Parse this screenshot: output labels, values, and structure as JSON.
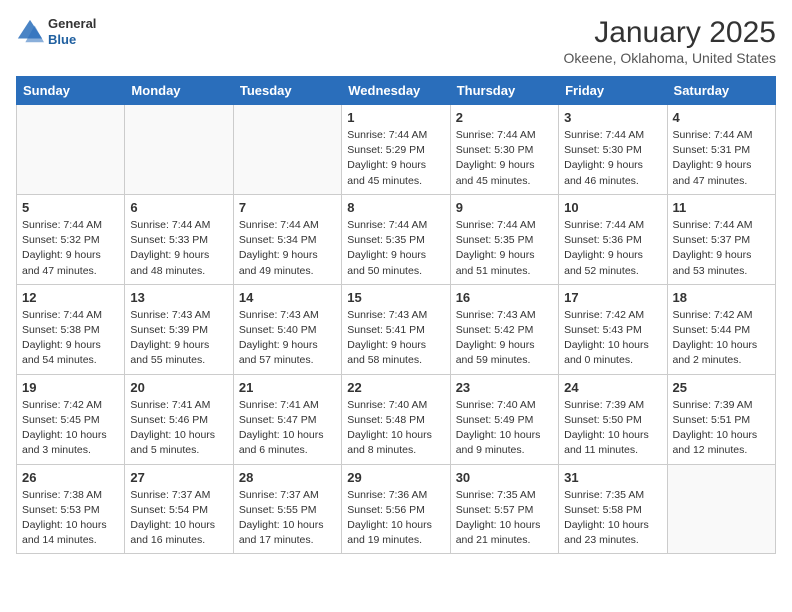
{
  "header": {
    "logo_line1": "General",
    "logo_line2": "Blue",
    "title": "January 2025",
    "subtitle": "Okeene, Oklahoma, United States"
  },
  "days_of_week": [
    "Sunday",
    "Monday",
    "Tuesday",
    "Wednesday",
    "Thursday",
    "Friday",
    "Saturday"
  ],
  "weeks": [
    [
      {
        "day": "",
        "detail": ""
      },
      {
        "day": "",
        "detail": ""
      },
      {
        "day": "",
        "detail": ""
      },
      {
        "day": "1",
        "detail": "Sunrise: 7:44 AM\nSunset: 5:29 PM\nDaylight: 9 hours and 45 minutes."
      },
      {
        "day": "2",
        "detail": "Sunrise: 7:44 AM\nSunset: 5:30 PM\nDaylight: 9 hours and 45 minutes."
      },
      {
        "day": "3",
        "detail": "Sunrise: 7:44 AM\nSunset: 5:30 PM\nDaylight: 9 hours and 46 minutes."
      },
      {
        "day": "4",
        "detail": "Sunrise: 7:44 AM\nSunset: 5:31 PM\nDaylight: 9 hours and 47 minutes."
      }
    ],
    [
      {
        "day": "5",
        "detail": "Sunrise: 7:44 AM\nSunset: 5:32 PM\nDaylight: 9 hours and 47 minutes."
      },
      {
        "day": "6",
        "detail": "Sunrise: 7:44 AM\nSunset: 5:33 PM\nDaylight: 9 hours and 48 minutes."
      },
      {
        "day": "7",
        "detail": "Sunrise: 7:44 AM\nSunset: 5:34 PM\nDaylight: 9 hours and 49 minutes."
      },
      {
        "day": "8",
        "detail": "Sunrise: 7:44 AM\nSunset: 5:35 PM\nDaylight: 9 hours and 50 minutes."
      },
      {
        "day": "9",
        "detail": "Sunrise: 7:44 AM\nSunset: 5:35 PM\nDaylight: 9 hours and 51 minutes."
      },
      {
        "day": "10",
        "detail": "Sunrise: 7:44 AM\nSunset: 5:36 PM\nDaylight: 9 hours and 52 minutes."
      },
      {
        "day": "11",
        "detail": "Sunrise: 7:44 AM\nSunset: 5:37 PM\nDaylight: 9 hours and 53 minutes."
      }
    ],
    [
      {
        "day": "12",
        "detail": "Sunrise: 7:44 AM\nSunset: 5:38 PM\nDaylight: 9 hours and 54 minutes."
      },
      {
        "day": "13",
        "detail": "Sunrise: 7:43 AM\nSunset: 5:39 PM\nDaylight: 9 hours and 55 minutes."
      },
      {
        "day": "14",
        "detail": "Sunrise: 7:43 AM\nSunset: 5:40 PM\nDaylight: 9 hours and 57 minutes."
      },
      {
        "day": "15",
        "detail": "Sunrise: 7:43 AM\nSunset: 5:41 PM\nDaylight: 9 hours and 58 minutes."
      },
      {
        "day": "16",
        "detail": "Sunrise: 7:43 AM\nSunset: 5:42 PM\nDaylight: 9 hours and 59 minutes."
      },
      {
        "day": "17",
        "detail": "Sunrise: 7:42 AM\nSunset: 5:43 PM\nDaylight: 10 hours and 0 minutes."
      },
      {
        "day": "18",
        "detail": "Sunrise: 7:42 AM\nSunset: 5:44 PM\nDaylight: 10 hours and 2 minutes."
      }
    ],
    [
      {
        "day": "19",
        "detail": "Sunrise: 7:42 AM\nSunset: 5:45 PM\nDaylight: 10 hours and 3 minutes."
      },
      {
        "day": "20",
        "detail": "Sunrise: 7:41 AM\nSunset: 5:46 PM\nDaylight: 10 hours and 5 minutes."
      },
      {
        "day": "21",
        "detail": "Sunrise: 7:41 AM\nSunset: 5:47 PM\nDaylight: 10 hours and 6 minutes."
      },
      {
        "day": "22",
        "detail": "Sunrise: 7:40 AM\nSunset: 5:48 PM\nDaylight: 10 hours and 8 minutes."
      },
      {
        "day": "23",
        "detail": "Sunrise: 7:40 AM\nSunset: 5:49 PM\nDaylight: 10 hours and 9 minutes."
      },
      {
        "day": "24",
        "detail": "Sunrise: 7:39 AM\nSunset: 5:50 PM\nDaylight: 10 hours and 11 minutes."
      },
      {
        "day": "25",
        "detail": "Sunrise: 7:39 AM\nSunset: 5:51 PM\nDaylight: 10 hours and 12 minutes."
      }
    ],
    [
      {
        "day": "26",
        "detail": "Sunrise: 7:38 AM\nSunset: 5:53 PM\nDaylight: 10 hours and 14 minutes."
      },
      {
        "day": "27",
        "detail": "Sunrise: 7:37 AM\nSunset: 5:54 PM\nDaylight: 10 hours and 16 minutes."
      },
      {
        "day": "28",
        "detail": "Sunrise: 7:37 AM\nSunset: 5:55 PM\nDaylight: 10 hours and 17 minutes."
      },
      {
        "day": "29",
        "detail": "Sunrise: 7:36 AM\nSunset: 5:56 PM\nDaylight: 10 hours and 19 minutes."
      },
      {
        "day": "30",
        "detail": "Sunrise: 7:35 AM\nSunset: 5:57 PM\nDaylight: 10 hours and 21 minutes."
      },
      {
        "day": "31",
        "detail": "Sunrise: 7:35 AM\nSunset: 5:58 PM\nDaylight: 10 hours and 23 minutes."
      },
      {
        "day": "",
        "detail": ""
      }
    ]
  ]
}
